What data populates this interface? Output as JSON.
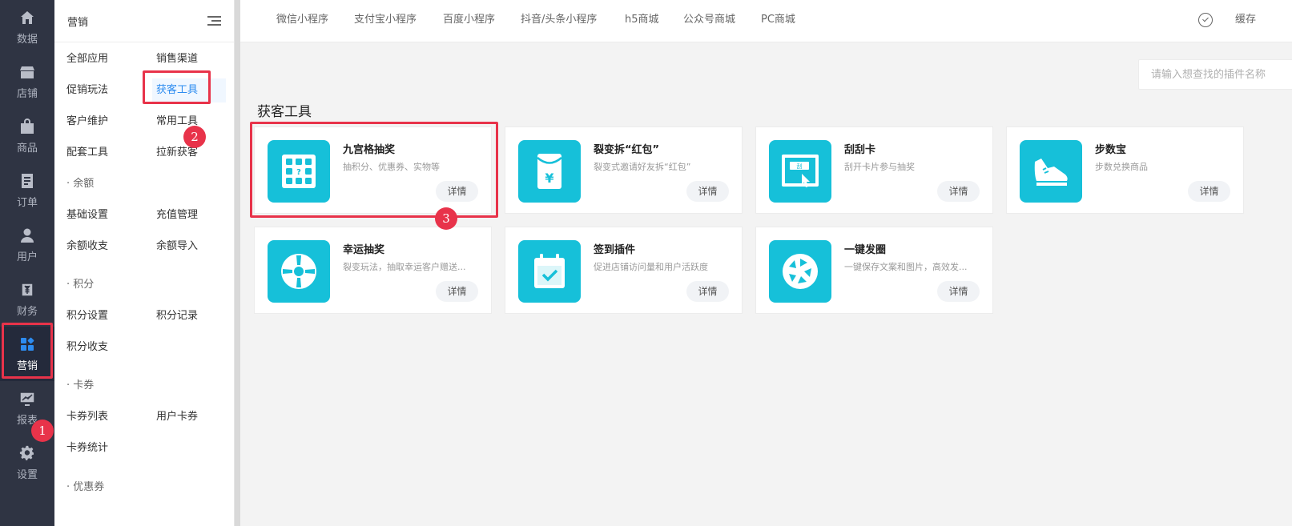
{
  "rail": {
    "items": [
      {
        "label": "数据",
        "icon": "home-icon"
      },
      {
        "label": "店铺",
        "icon": "store-icon"
      },
      {
        "label": "商品",
        "icon": "bag-icon"
      },
      {
        "label": "订单",
        "icon": "order-icon"
      },
      {
        "label": "用户",
        "icon": "user-icon"
      },
      {
        "label": "财务",
        "icon": "finance-icon"
      },
      {
        "label": "营销",
        "icon": "marketing-icon",
        "active": true
      },
      {
        "label": "报表",
        "icon": "chart-icon"
      },
      {
        "label": "设置",
        "icon": "gear-icon"
      }
    ]
  },
  "submenu": {
    "title": "营销",
    "items": [
      "全部应用",
      "销售渠道",
      "促销玩法",
      "获客工具",
      "客户维护",
      "常用工具",
      "配套工具",
      "拉新获客"
    ],
    "group_balance": "· 余额",
    "balance_items": [
      "基础设置",
      "充值管理",
      "余额收支",
      "余额导入"
    ],
    "group_points": "· 积分",
    "points_items": [
      "积分设置",
      "积分记录",
      "积分收支"
    ],
    "group_cards": "· 卡券",
    "cards_items": [
      "卡券列表",
      "用户卡券",
      "卡券统计"
    ],
    "group_coupons": "· 优惠券"
  },
  "topnav": {
    "tabs": [
      "微信小程序",
      "支付宝小程序",
      "百度小程序",
      "抖音/头条小程序",
      "h5商城",
      "公众号商城",
      "PC商城"
    ],
    "cache_label": "缓存"
  },
  "search": {
    "placeholder": "请输入想查找的插件名称"
  },
  "section_title": "获客工具",
  "cards": [
    {
      "title": "九宫格抽奖",
      "desc": "抽积分、优惠券、实物等",
      "btn": "详情",
      "icon": "grid-lottery-icon"
    },
    {
      "title": "裂变拆“红包”",
      "desc": "裂变式邀请好友拆“红包”",
      "btn": "详情",
      "icon": "red-envelope-icon"
    },
    {
      "title": "刮刮卡",
      "desc": "刮开卡片参与抽奖",
      "btn": "详情",
      "icon": "scratch-card-icon"
    },
    {
      "title": "步数宝",
      "desc": "步数兑换商品",
      "btn": "详情",
      "icon": "sneaker-icon"
    },
    {
      "title": "幸运抽奖",
      "desc": "裂变玩法，抽取幸运客户赠送...",
      "btn": "详情",
      "icon": "wheel-icon"
    },
    {
      "title": "签到插件",
      "desc": "促进店铺访问量和用户活跃度",
      "btn": "详情",
      "icon": "calendar-check-icon"
    },
    {
      "title": "一键发圈",
      "desc": "一键保存文案和图片，高效发...",
      "btn": "详情",
      "icon": "shutter-icon"
    }
  ],
  "annotations": [
    "1",
    "2",
    "3"
  ],
  "colors": {
    "rail_bg": "#2f3443",
    "accent": "#2d8cf0",
    "card_icon_bg": "#16c0d9",
    "highlight": "#e8334a"
  }
}
